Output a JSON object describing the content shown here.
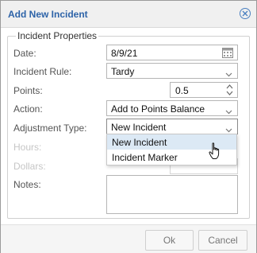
{
  "dialog": {
    "title": "Add New Incident",
    "close_icon": "close-circle-icon"
  },
  "form": {
    "legend": "Incident Properties",
    "date": {
      "label": "Date:",
      "value": "8/9/21",
      "icon": "calendar-icon"
    },
    "incident_rule": {
      "label": "Incident Rule:",
      "value": "Tardy"
    },
    "points": {
      "label": "Points:",
      "value": "0.5"
    },
    "action": {
      "label": "Action:",
      "value": "Add to Points Balance"
    },
    "adjustment_type": {
      "label": "Adjustment Type:",
      "value": "New Incident",
      "options": [
        "New Incident",
        "Incident Marker"
      ],
      "hovered_option": "New Incident"
    },
    "hours": {
      "label": "Hours:"
    },
    "dollars": {
      "label": "Dollars:"
    },
    "notes": {
      "label": "Notes:",
      "value": ""
    }
  },
  "footer": {
    "ok_label": "Ok",
    "cancel_label": "Cancel"
  },
  "colors": {
    "title_text": "#2d63a8",
    "dropdown_hover": "#dce9f5",
    "disabled_label": "#c6c6c6"
  }
}
